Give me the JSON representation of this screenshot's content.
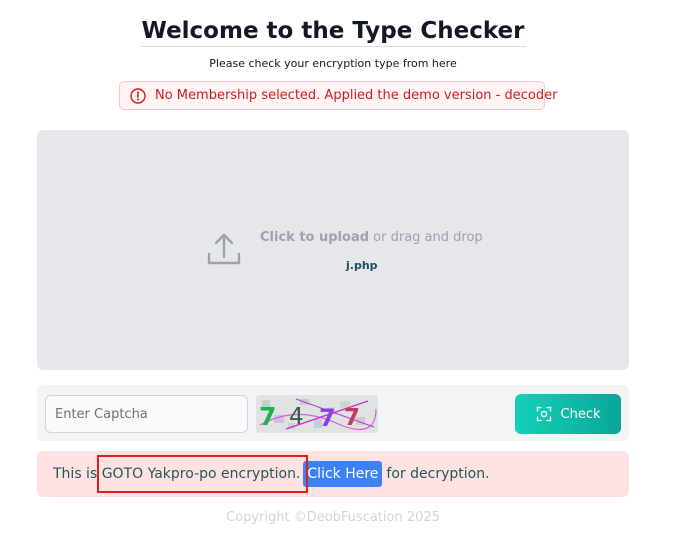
{
  "header": {
    "title": "Welcome to the Type Checker",
    "subtitle": "Please check your encryption type from here"
  },
  "alert": {
    "message": "No Membership selected. Applied the demo version - decoder",
    "icon": "exclamation-circle-icon",
    "color": "#c81e1e"
  },
  "upload": {
    "icon": "upload-icon",
    "click_label": "Click to upload",
    "drag_label": "or drag and drop",
    "file_name": "j.php"
  },
  "captcha": {
    "placeholder": "Enter Captcha",
    "value": "",
    "image_text": "7 4 7 7",
    "check_label": "Check",
    "check_icon": "scan-icon",
    "accent": "#14d1b8"
  },
  "result": {
    "prefix": "This is",
    "encryption": "GOTO Yakpro-po encryption.",
    "link_label": "Click Here",
    "suffix": "for decryption.",
    "link_color": "#3b82f6",
    "highlight_color": "#e11d1d"
  },
  "footer": {
    "copyright": "Copyright ©DeobFuscation 2025"
  }
}
